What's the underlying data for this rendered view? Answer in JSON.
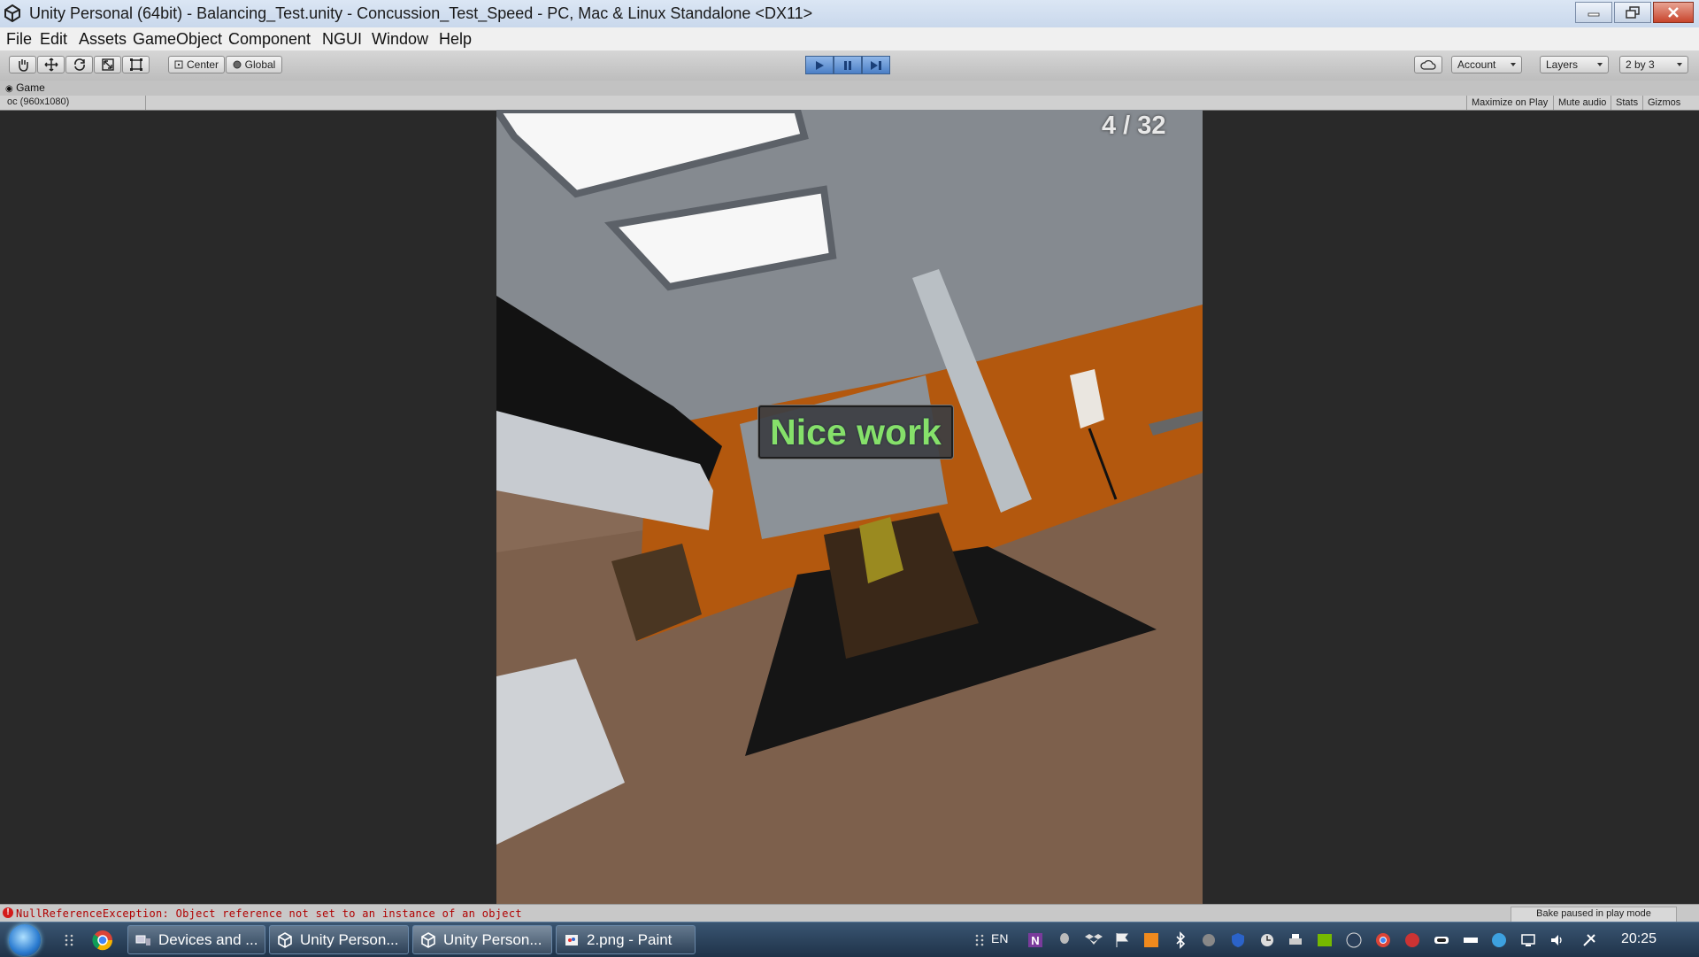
{
  "window": {
    "title": "Unity Personal (64bit) - Balancing_Test.unity - Concussion_Test_Speed - PC, Mac & Linux Standalone <DX11>"
  },
  "menu": [
    "File",
    "Edit",
    "Assets",
    "GameObject",
    "Component",
    "NGUI",
    "Window",
    "Help"
  ],
  "toolbar": {
    "pivot_label": "Center",
    "space_label": "Global",
    "account_label": "Account",
    "layers_label": "Layers",
    "layout_label": "2 by 3"
  },
  "game_view": {
    "tab_label": "Game",
    "resolution": "oc (960x1080)",
    "options": [
      "Maximize on Play",
      "Mute audio",
      "Stats",
      "Gizmos"
    ],
    "counter": "4 / 32",
    "message": "Nice work"
  },
  "status": {
    "error": "NullReferenceException: Object reference not set to an instance of an object",
    "bake": "Bake paused in play mode"
  },
  "taskbar": {
    "items": [
      "Devices and ...",
      "Unity Person...",
      "Unity Person...",
      "2.png - Paint"
    ],
    "language": "EN",
    "clock": "20:25"
  },
  "colors": {
    "accent_play": "#4b7fc6",
    "wall_orange": "#b3580e",
    "nice_work_green": "#86e06a",
    "error_red": "#b00000"
  }
}
